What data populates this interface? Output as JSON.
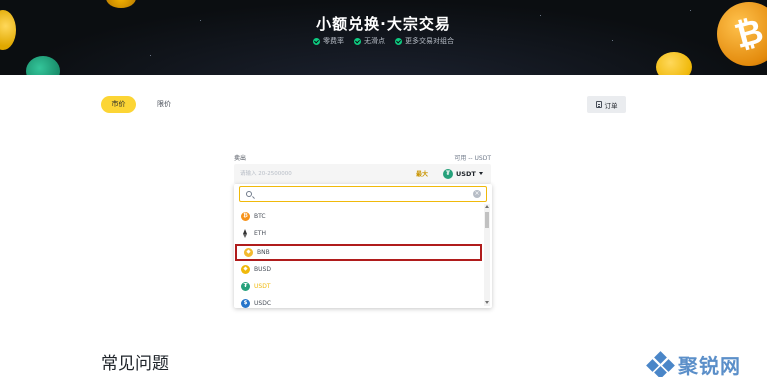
{
  "banner": {
    "title": "小额兑换·大宗交易",
    "features": [
      "零费率",
      "无滑点",
      "更多交易对组合"
    ]
  },
  "tabs": {
    "market": "市价",
    "limit": "限价"
  },
  "orders_button": "订单",
  "trade": {
    "sell_label": "卖出",
    "available": "可用 -- USDT",
    "amount_placeholder": "请输入 20-2500000",
    "max": "最大",
    "currency": "USDT",
    "search_value": ""
  },
  "dropdown": {
    "items": [
      {
        "symbol": "BTC",
        "icon": "btc-icon",
        "selected": false,
        "highlighted": false
      },
      {
        "symbol": "ETH",
        "icon": "eth-icon",
        "selected": false,
        "highlighted": false
      },
      {
        "symbol": "BNB",
        "icon": "bnb-icon",
        "selected": false,
        "highlighted": true
      },
      {
        "symbol": "BUSD",
        "icon": "busd-icon",
        "selected": false,
        "highlighted": false
      },
      {
        "symbol": "USDT",
        "icon": "usdt-icon",
        "selected": true,
        "highlighted": false
      },
      {
        "symbol": "USDC",
        "icon": "usdc-icon",
        "selected": false,
        "highlighted": false
      }
    ]
  },
  "faq": {
    "title": "常见问题"
  },
  "watermark": {
    "text": "聚锐网"
  },
  "colors": {
    "accent": "#fcd535",
    "banner_bg": "#0b0e11",
    "highlight_border": "#b01c1c",
    "selected_text": "#f0b90b"
  }
}
